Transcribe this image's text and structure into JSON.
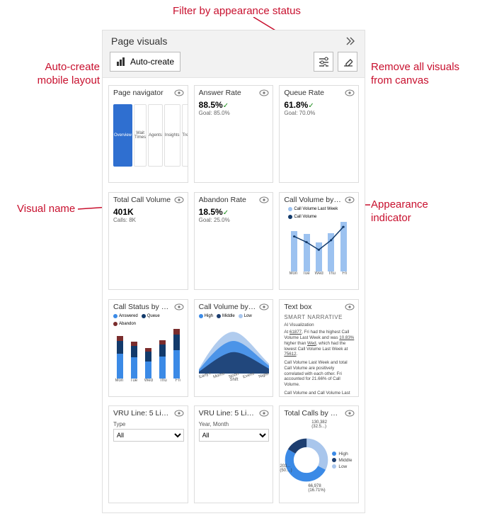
{
  "panel": {
    "title": "Page visuals",
    "auto_create": "Auto-create"
  },
  "annotations": {
    "filter": "Filter by appearance status",
    "auto_line1": "Auto-create",
    "auto_line2": "mobile layout",
    "remove_line1": "Remove all visuals",
    "remove_line2": "from canvas",
    "visual_name": "Visual name",
    "appearance": "Appearance",
    "appearance2": "indicator"
  },
  "cards": [
    {
      "name": "Page navigator",
      "type": "pagenav",
      "tabs": [
        "Overview",
        "Wait Times",
        "Agents",
        "Insights",
        "Trends"
      ],
      "active": 0
    },
    {
      "name": "Answer Rate",
      "type": "kpi",
      "value": "88.5%",
      "goal": "Goal: 85.0%"
    },
    {
      "name": "Queue Rate",
      "type": "kpi",
      "value": "61.8%",
      "goal": "Goal: 70.0%"
    },
    {
      "name": "Total Call Volume",
      "type": "kpi",
      "value": "401K",
      "goal": "Calls: 8K",
      "nocheck": true
    },
    {
      "name": "Abandon Rate",
      "type": "kpi",
      "value": "18.5%",
      "goal": "Goal: 25.0%"
    },
    {
      "name": "Call Volume by ...",
      "type": "combo",
      "legend": [
        {
          "label": "Call Volume Last Week",
          "color": "#9cc2f0"
        },
        {
          "label": "Call Volume",
          "color": "#123a6b"
        }
      ],
      "ylabel_left": "Call Volume Last Week",
      "ylabel_right": "Call Volume",
      "cats": [
        "Mon",
        "Tue",
        "Wed",
        "Thu",
        "Fri"
      ],
      "bars": [
        58,
        54,
        42,
        55,
        72
      ],
      "line": [
        34,
        28,
        20,
        30,
        44
      ]
    },
    {
      "name": "Call Status by W...",
      "type": "stacked",
      "legend": [
        {
          "label": "Answered",
          "color": "#3b8ae6"
        },
        {
          "label": "Queue",
          "color": "#123a6b"
        },
        {
          "label": "Abandon",
          "color": "#7a2d2d"
        }
      ],
      "cats": [
        "Mon",
        "Tue",
        "Wed",
        "Thu",
        "Fri"
      ],
      "stacks": [
        [
          40,
          22,
          8
        ],
        [
          35,
          18,
          7
        ],
        [
          28,
          16,
          6
        ],
        [
          36,
          20,
          7
        ],
        [
          46,
          26,
          10
        ]
      ]
    },
    {
      "name": "Call Volume by S...",
      "type": "area",
      "legend": [
        {
          "label": "High",
          "color": "#3b8ae6"
        },
        {
          "label": "Middle",
          "color": "#1d3e70"
        },
        {
          "label": "Low",
          "color": "#a9c6ec"
        }
      ],
      "xlabel": "Shift",
      "cats": [
        "Early Morning",
        "Morning",
        "Noon",
        "Evening",
        "Night"
      ]
    },
    {
      "name": "Text box",
      "type": "text",
      "header": "SMART NARRATIVE",
      "sub": "AI Visualization",
      "p1a": "At ",
      "p1b": "61877",
      "p1c": ", Fri had the highest Call Volume Last Week and was ",
      "p1d": "10.83%",
      "p1e": " higher than ",
      "p1f": "Wed",
      "p1g": ", which had the lowest Call Volume Last Week at ",
      "p1h": "75612",
      "p1i": ".",
      "p2": "Call Volume Last Week and total Call Volume are positively correlated with each other. Fri accounted for 21.66% of Call Volume.",
      "p3": "Call Volume and Call Volume Last Week"
    },
    {
      "name": "VRU Line: 5 Line...",
      "type": "slicer",
      "label": "Type",
      "value": "All"
    },
    {
      "name": "VRU Line: 5 Line...",
      "type": "slicer",
      "label": "Year, Month",
      "value": "All"
    },
    {
      "name": "Total Calls by Pri...",
      "type": "donut",
      "legend": [
        {
          "label": "High",
          "color": "#3b8ae6"
        },
        {
          "label": "Middle",
          "color": "#1d3e70"
        },
        {
          "label": "Low",
          "color": "#a9c6ec"
        }
      ],
      "slices": [
        {
          "label": "130,382",
          "pct": "(32.5...)",
          "color": "#a9c6ec",
          "start": 0,
          "end": 117
        },
        {
          "label": "203...",
          "pct": "(50....)",
          "color": "#3b8ae6",
          "start": 117,
          "end": 300
        },
        {
          "label": "66,978",
          "pct": "(16.71%)",
          "color": "#1d3e70",
          "start": 300,
          "end": 360
        }
      ]
    }
  ]
}
